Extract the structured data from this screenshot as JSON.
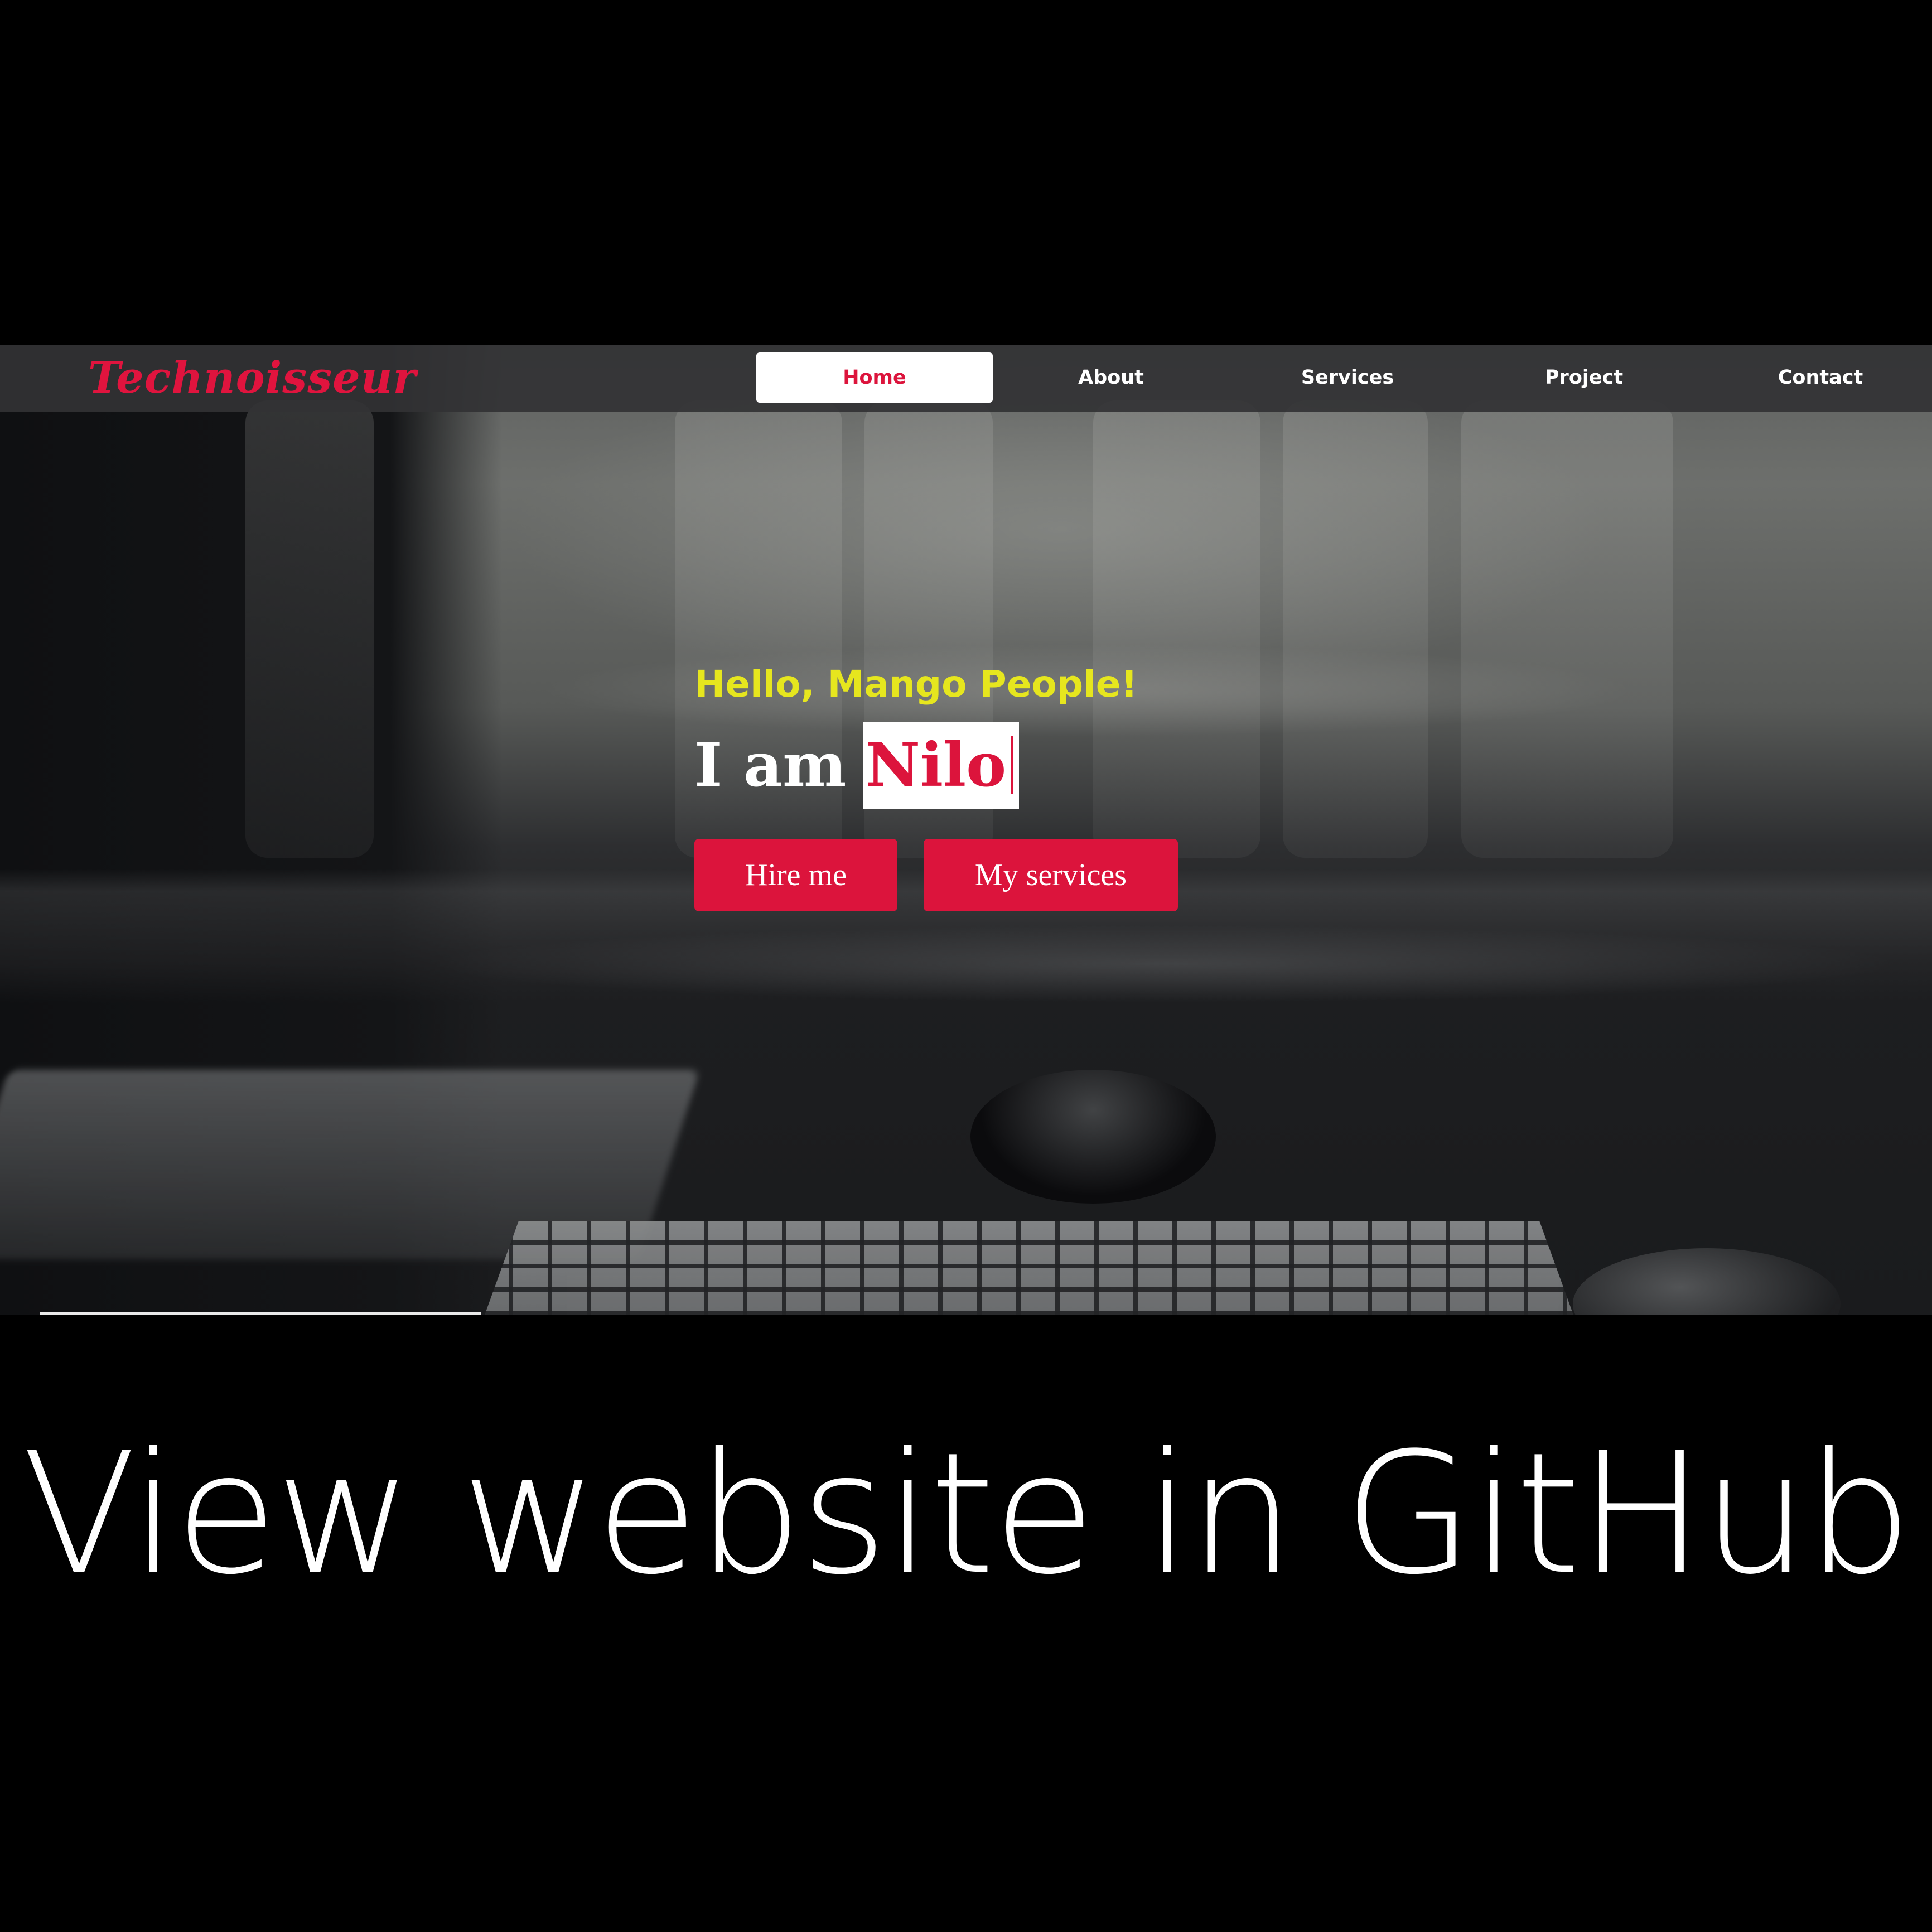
{
  "navbar": {
    "logo": "Technoisseur",
    "items": [
      {
        "label": "Home",
        "active": true
      },
      {
        "label": "About",
        "active": false
      },
      {
        "label": "Services",
        "active": false
      },
      {
        "label": "Project",
        "active": false
      },
      {
        "label": "Contact",
        "active": false
      }
    ]
  },
  "hero": {
    "greeting": "Hello, Mango People!",
    "headline_prefix": "I am",
    "headline_name": "Nilo",
    "buttons": {
      "hire": "Hire me",
      "services": "My services"
    }
  },
  "caption": "View website in GitHub",
  "colors": {
    "accent": "#dc143c",
    "greeting": "#e6e61e",
    "navbar_bg": "#323234",
    "page_bg": "#000000"
  },
  "icons": [
    "text-cursor-icon"
  ]
}
